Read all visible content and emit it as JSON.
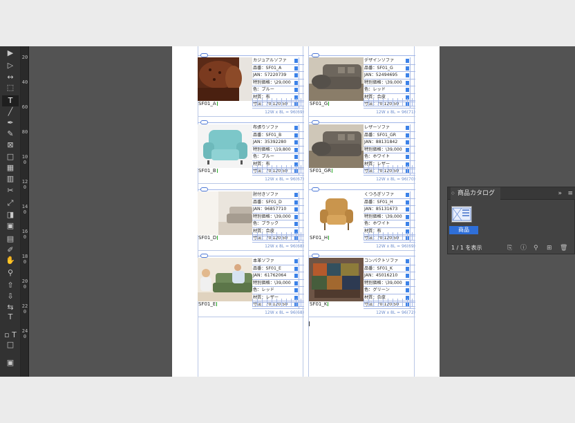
{
  "toolbar": {
    "tools": [
      {
        "name": "selection-tool-icon",
        "glyph": "▶",
        "active": false
      },
      {
        "name": "direct-selection-tool-icon",
        "glyph": "▷",
        "active": false
      },
      {
        "name": "gap-tool-icon",
        "glyph": "↔",
        "active": false
      },
      {
        "name": "content-collector-icon",
        "glyph": "⬚",
        "active": false
      },
      {
        "name": "type-tool-icon",
        "glyph": "T",
        "active": true
      },
      {
        "name": "line-tool-icon",
        "glyph": "╱",
        "active": false
      },
      {
        "name": "pen-tool-icon",
        "glyph": "✒",
        "active": false
      },
      {
        "name": "pencil-tool-icon",
        "glyph": "✎",
        "active": false
      },
      {
        "name": "rectangle-frame-tool-icon",
        "glyph": "⊠",
        "active": false
      },
      {
        "name": "rectangle-tool-icon",
        "glyph": "□",
        "active": false
      },
      {
        "name": "table-tool-icon",
        "glyph": "▦",
        "active": false
      },
      {
        "name": "table-tool-2-icon",
        "glyph": "▥",
        "active": false
      },
      {
        "name": "scissors-tool-icon",
        "glyph": "✂",
        "active": false
      },
      {
        "name": "free-transform-tool-icon",
        "glyph": "⤢",
        "active": false
      },
      {
        "name": "gradient-swatch-tool-icon",
        "glyph": "◨",
        "active": false
      },
      {
        "name": "gradient-feather-tool-icon",
        "glyph": "▣",
        "active": false
      },
      {
        "name": "note-tool-icon",
        "glyph": "▤",
        "active": false
      },
      {
        "name": "eyedropper-tool-icon",
        "glyph": "✐",
        "active": false
      },
      {
        "name": "hand-tool-icon",
        "glyph": "✋",
        "active": false
      },
      {
        "name": "zoom-tool-icon",
        "glyph": "⚲",
        "active": false
      },
      {
        "name": "page-tool-icon",
        "glyph": "⇧",
        "active": false
      },
      {
        "name": "place-tool-icon",
        "glyph": "⇩",
        "active": false
      },
      {
        "name": "swap-fill-stroke-icon",
        "glyph": "⇆",
        "active": false
      },
      {
        "name": "fill-stroke-text-icon",
        "glyph": "T",
        "active": false
      },
      {
        "name": "apply-color-icon",
        "glyph": "▫ T",
        "active": false
      },
      {
        "name": "screen-mode-icon",
        "glyph": "□",
        "active": false
      },
      {
        "name": "view-mode-icon",
        "glyph": "▣",
        "active": false
      }
    ]
  },
  "ruler": {
    "labels": [
      "20",
      "40",
      "60",
      "80",
      "100",
      "120",
      "140",
      "160",
      "180",
      "200",
      "220",
      "240"
    ]
  },
  "products": [
    {
      "code": "SF01_A",
      "fields": [
        "カジュアルソファ",
        "品番：SF01_A",
        "JAN：57220739",
        "特別価格：\\29,000",
        "色：ブルー",
        "材質：布",
        "寸法：70.120.50"
      ],
      "caption": "12W x 8L = 96(69)",
      "photo": "leather"
    },
    {
      "code": "SF01_G",
      "fields": [
        "デザインソファ",
        "品番：SF01_G",
        "JAN：52494695",
        "特別価格：\\39,000",
        "色：レッド",
        "材質：合皮",
        "寸法：70.120.50"
      ],
      "caption": "12W x 8L = 96(71)",
      "photo": "grey-sofa"
    },
    {
      "code": "SF01_B",
      "fields": [
        "布張りソファ",
        "品番：SF01_B",
        "JAN：35392280",
        "特別価格：\\19,800",
        "色：ブルー",
        "材質：布",
        "寸法：70.120.50"
      ],
      "caption": "12W x 8L = 96(67)",
      "photo": "teal-chair"
    },
    {
      "code": "SF01_GR",
      "fields": [
        "レザーソファ",
        "品番：SF01_GR",
        "JAN：88131842",
        "特別価格：\\39,000",
        "色：ホワイト",
        "材質：レザー",
        "寸法：70.120.50"
      ],
      "caption": "12W x 8L = 96(70)",
      "photo": "grey-sofa"
    },
    {
      "code": "SF01_D",
      "fields": [
        "肘付きソファ",
        "品番：SF01_D",
        "JAN：96857710",
        "特別価格：\\39,000",
        "色：ブラック",
        "材質：合皮",
        "寸法：70.120.50"
      ],
      "caption": "12W x 8L = 96(68)",
      "photo": "room-sofa"
    },
    {
      "code": "SF01_H",
      "fields": [
        "くつろぎソファ",
        "品番：SF01_H",
        "JAN：85131673",
        "特別価格：\\39,000",
        "色：ホワイト",
        "材質：布",
        "寸法：70.120.50"
      ],
      "caption": "12W x 8L = 96(69)",
      "photo": "tan-chair"
    },
    {
      "code": "SF01_E",
      "fields": [
        "本革ソファ",
        "品番：SF01_E",
        "JAN：61762064",
        "特別価格：\\39,000",
        "色：レッド",
        "材質：レザー",
        "寸法：70.120.50"
      ],
      "caption": "12W x 8L = 96(68)",
      "photo": "people"
    },
    {
      "code": "SF01_K",
      "fields": [
        "コンパクトソファ",
        "品番：SF01_K",
        "JAN：45016210",
        "特別価格：\\39,000",
        "色：グリーン",
        "材質：合皮",
        "寸法：70.120.50"
      ],
      "caption": "12W x 8L = 96(72)",
      "photo": "patchwork"
    }
  ],
  "panel": {
    "title": "商品カタログ",
    "arrows": "»",
    "item_label": "商品",
    "count": "1 / 1 を表示"
  },
  "colors": {
    "selection_blue": "#2f6fd8",
    "frame_blue": "#3c82e8"
  }
}
